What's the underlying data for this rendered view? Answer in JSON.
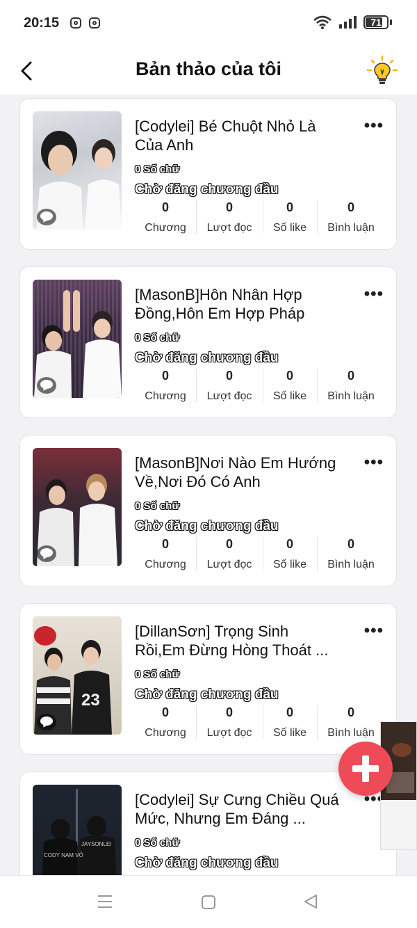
{
  "status_bar": {
    "time": "20:15",
    "battery": "71"
  },
  "header": {
    "title": "Bản thảo của tôi"
  },
  "stat_labels": {
    "chapters": "Chương",
    "reads": "Lượt đọc",
    "likes": "Số like",
    "comments": "Bình luận"
  },
  "drafts": [
    {
      "title": "[Codylei] Bé Chuột Nhỏ Là Của Anh",
      "word_count": "0 Số chữ",
      "status": "Chờ đăng chương đầu",
      "chapters": "0",
      "reads": "0",
      "likes": "0",
      "comments": "0"
    },
    {
      "title": "[MasonB]Hôn Nhân Hợp Đồng,Hôn Em Hợp Pháp",
      "word_count": "0 Số chữ",
      "status": "Chờ đăng chương đầu",
      "chapters": "0",
      "reads": "0",
      "likes": "0",
      "comments": "0"
    },
    {
      "title": "[MasonB]Nơi Nào Em Hướng Về,Nơi Đó Có Anh",
      "word_count": "0 Số chữ",
      "status": "Chờ đăng chương đầu",
      "chapters": "0",
      "reads": "0",
      "likes": "0",
      "comments": "0"
    },
    {
      "title": "[DillanSơn] Trọng Sinh Rồi,Em Đừng Hòng Thoát ...",
      "word_count": "0 Số chữ",
      "status": "Chờ đăng chương đầu",
      "chapters": "0",
      "reads": "0",
      "likes": "0",
      "comments": "0"
    },
    {
      "title": "[Codylei] Sự Cưng Chiều Quá Mức, Nhưng Em Đáng ...",
      "word_count": "0 Số chữ",
      "status": "Chờ đăng chương đầu"
    }
  ],
  "fab_icon": "plus-icon"
}
